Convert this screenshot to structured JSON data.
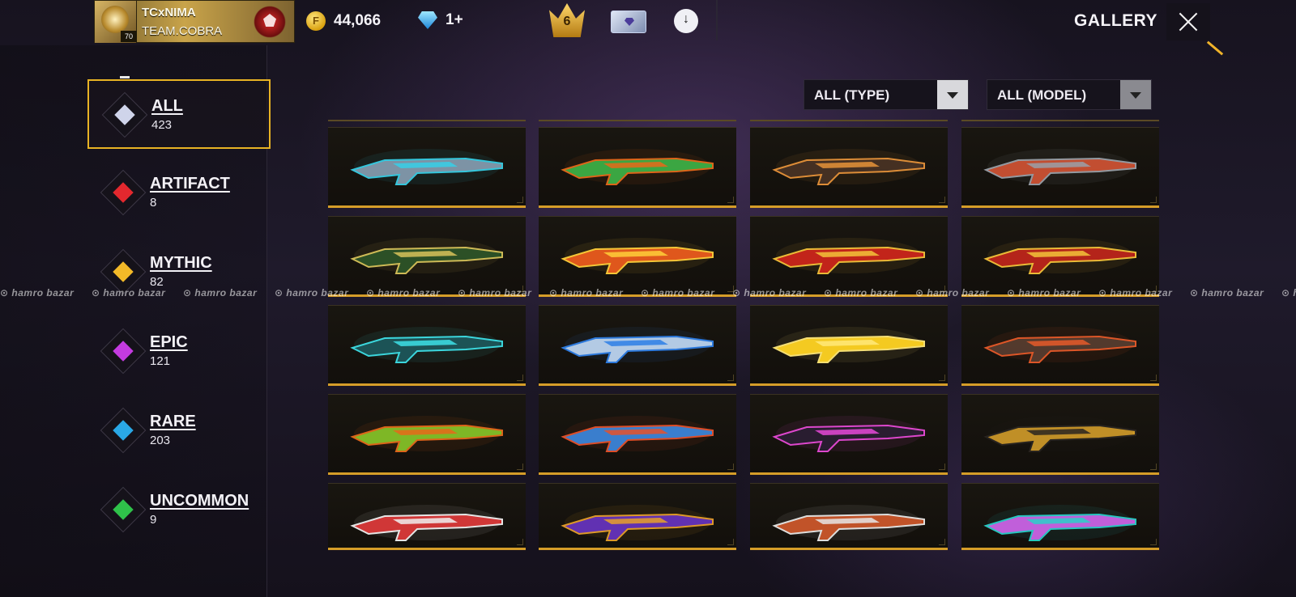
{
  "header": {
    "player_name": "TCxNIMA",
    "team_name": "TEAM.COBRA",
    "level": "70",
    "gold": "44,066",
    "diamonds": "1+",
    "crown_level": "6",
    "title": "GALLERY"
  },
  "sidebar": {
    "items": [
      {
        "label": "ALL",
        "count": "423",
        "color": "#cfd4ea",
        "active": true
      },
      {
        "label": "ARTIFACT",
        "count": "8",
        "color": "#e3282e"
      },
      {
        "label": "MYTHIC",
        "count": "82",
        "color": "#f2b928"
      },
      {
        "label": "EPIC",
        "count": "121",
        "color": "#c43be0"
      },
      {
        "label": "RARE",
        "count": "203",
        "color": "#2aa8e6"
      },
      {
        "label": "UNCOMMON",
        "count": "9",
        "color": "#2fc24a"
      }
    ]
  },
  "filters": {
    "type": "ALL (TYPE)",
    "model": "ALL (MODEL)"
  },
  "grid": {
    "rows": [
      [
        {
          "name": "rifle-icon",
          "c1": "#8a96a8",
          "c2": "#37d0e8"
        },
        {
          "name": "sniper-icon",
          "c1": "#2fb54a",
          "c2": "#e86a1a"
        },
        {
          "name": "smg-icon",
          "c1": "#3a2a22",
          "c2": "#e8933a"
        },
        {
          "name": "shotgun-icon",
          "c1": "#d04a2a",
          "c2": "#9aa0a8"
        }
      ],
      [
        {
          "name": "spirit-rifle-icon",
          "c1": "#1f4a24",
          "c2": "#d8c35a"
        },
        {
          "name": "flame-rifle-icon",
          "c1": "#e8521a",
          "c2": "#ffd03a"
        },
        {
          "name": "dragon-lmg-icon",
          "c1": "#c81818",
          "c2": "#f5c43a"
        },
        {
          "name": "demon-rifle-icon",
          "c1": "#b81818",
          "c2": "#f5c43a"
        }
      ],
      [
        {
          "name": "frost-spear-icon",
          "c1": "#1a4a4e",
          "c2": "#3ee0e8"
        },
        {
          "name": "ice-pistol-icon",
          "c1": "#c8dcf0",
          "c2": "#2e7fe8"
        },
        {
          "name": "golden-orb-icon",
          "c1": "#ffd21a",
          "c2": "#ffe97a"
        },
        {
          "name": "chainsaw-icon",
          "c1": "#4a3a30",
          "c2": "#e85a2a"
        }
      ],
      [
        {
          "name": "serpent-blade-icon",
          "c1": "#7cc82a",
          "c2": "#e86a1a"
        },
        {
          "name": "wave-blade-icon",
          "c1": "#2e8ae8",
          "c2": "#e8522a"
        },
        {
          "name": "pixel-staff-icon",
          "c1": "#1a1a24",
          "c2": "#e84ad8"
        },
        {
          "name": "golden-shovel-icon",
          "c1": "#d8a02a",
          "c2": "#2a2420"
        }
      ],
      [
        {
          "name": "guitar-icon",
          "c1": "#d82a2a",
          "c2": "#f0f0f0"
        },
        {
          "name": "rock-bat-icon",
          "c1": "#5a2ac8",
          "c2": "#e8a02a"
        },
        {
          "name": "katana-icon",
          "c1": "#c84a1a",
          "c2": "#e8e8e8"
        },
        {
          "name": "neon-katana-icon",
          "c1": "#d85ae8",
          "c2": "#2ad0c8"
        }
      ]
    ]
  },
  "watermark": {
    "text": "hamro bazar"
  }
}
